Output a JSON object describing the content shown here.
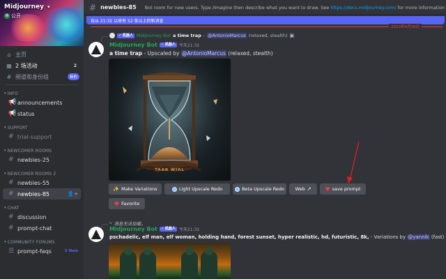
{
  "server": {
    "name": "Midjourney",
    "public_label": "公开",
    "chevron": "▾"
  },
  "nav": {
    "home": "主页",
    "events": "2 场活动",
    "events_count": "2",
    "browse": "频道和身份组",
    "browse_tag": "新的"
  },
  "categories": [
    {
      "label": "INFO",
      "channels": [
        {
          "name": "announcements"
        },
        {
          "name": "status"
        }
      ]
    },
    {
      "label": "SUPPORT",
      "channels": [
        {
          "name": "trial-support"
        }
      ]
    },
    {
      "label": "NEWCOMER ROOMS",
      "channels": [
        {
          "name": "newbies-25"
        }
      ]
    },
    {
      "label": "NEWCOMER ROOMS 2",
      "channels": [
        {
          "name": "newbies-55"
        },
        {
          "name": "newbies-85"
        }
      ]
    },
    {
      "label": "CHAT",
      "channels": [
        {
          "name": "discussion"
        },
        {
          "name": "prompt-chat"
        }
      ]
    },
    {
      "label": "COMMUNITY FORUMS",
      "channels": [
        {
          "name": "prompt-faqs",
          "badge": "5 New"
        }
      ]
    }
  ],
  "header": {
    "channel": "newbies-85",
    "topic_prefix": "Bot room for new users. Type /imagine then describe what you want to draw. See ",
    "topic_link": "https://docs.midjourney.com/",
    "topic_suffix": " for more information"
  },
  "notice": "自从 21:32 以来有 52 条以上的新消息",
  "date_divider": "2023年4月16日",
  "message1": {
    "reply_badge": "✓ 机器人",
    "reply_author": "Midjourney Bot",
    "reply_text": "a time trap",
    "reply_sep": " - ",
    "reply_mention": "@AntonioMarcus",
    "reply_suffix": " (relaxed, stealth)",
    "author": "Midjourney Bot",
    "badge": "✓ 机器人",
    "timestamp": "今天21:32",
    "prompt": "a time trap",
    "middle": " - Upscaled by ",
    "mention": "@AntonioMarcus",
    "suffix": " (relaxed, stealth)",
    "image_caption": "TAAR WIAL",
    "buttons": {
      "make_variations": "Make Variations",
      "light_upscale": "Light Upscale Redo",
      "beta_upscale": "Beta Upscale Redo",
      "web": "Web",
      "save_prompt": "save prompt",
      "favorite": "Favorite"
    }
  },
  "message2": {
    "reply_text": "消息无法加载。",
    "author": "Midjourney Bot",
    "badge": "✓ 机器人",
    "timestamp": "今天21:32",
    "prompt": "pschadelic, elf man, elf woman, holding hand, forest sunset, hyper realistic, hd, futuristic, 8k,",
    "middle": " - Variations by ",
    "mention": "@yannik",
    "suffix": " (fast)"
  },
  "colors": {
    "accent": "#5865f2",
    "bot_green": "#23a559",
    "divider_red": "#f23f43",
    "link": "#00a8fc"
  }
}
